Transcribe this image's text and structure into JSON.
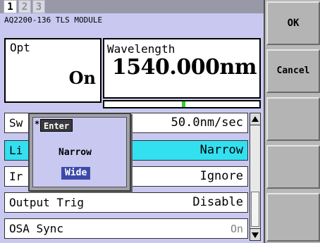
{
  "tabs": [
    "1",
    "2",
    "3"
  ],
  "module_title": "AQ2200-136 TLS MODULE",
  "opt": {
    "label": "Opt",
    "value": "On"
  },
  "wavelength": {
    "label": "Wavelength",
    "value": "1540.000nm"
  },
  "settings": [
    {
      "label": "Sw",
      "value": "50.0nm/sec"
    },
    {
      "label": "Li",
      "value": "Narrow"
    },
    {
      "label": "Ir",
      "value": "Ignore"
    },
    {
      "label": "Output Trig",
      "value": "Disable"
    },
    {
      "label": "OSA Sync",
      "value": "On"
    }
  ],
  "popup": {
    "star": "*",
    "title": "Enter",
    "options": [
      "Narrow",
      "Wide"
    ],
    "selected": "Wide"
  },
  "side_buttons": {
    "ok": "OK",
    "cancel": "Cancel"
  },
  "colors": {
    "panel": "#c8c8f0",
    "highlight_row": "#33e0f0",
    "selected_option": "#3d4aa8"
  }
}
